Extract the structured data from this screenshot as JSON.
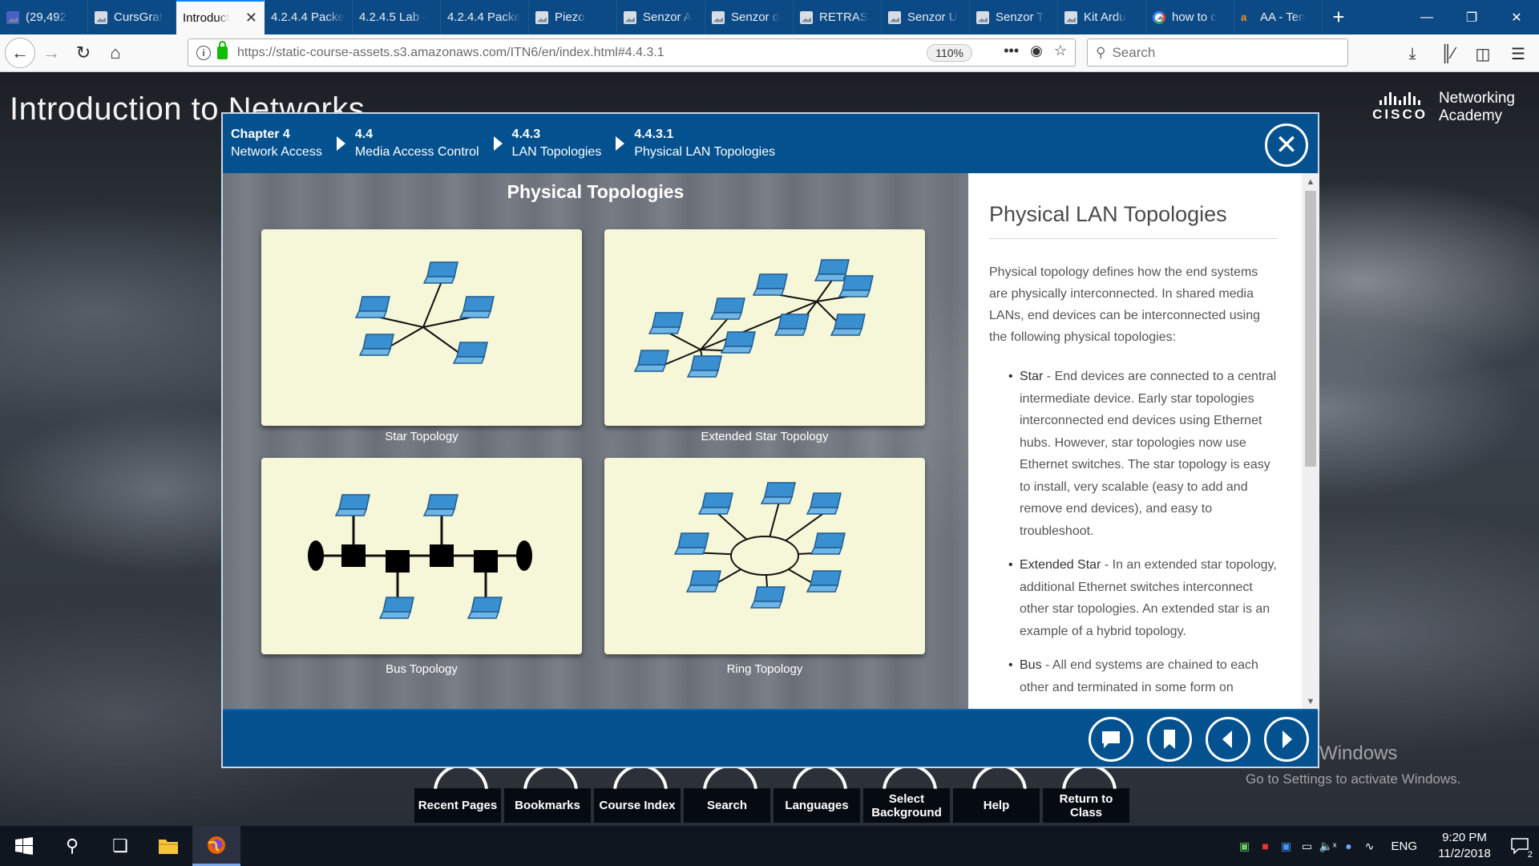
{
  "browser": {
    "tabs": [
      {
        "label": "(29,492",
        "icon": "mail-icon",
        "active": false
      },
      {
        "label": "CursGrat",
        "icon": "page-icon",
        "active": false
      },
      {
        "label": "Introduct",
        "icon": "none",
        "active": true
      },
      {
        "label": "4.2.4.4 Packe",
        "icon": "none",
        "active": false
      },
      {
        "label": "4.2.4.5 Lab -",
        "icon": "none",
        "active": false
      },
      {
        "label": "4.2.4.4 Packe",
        "icon": "none",
        "active": false
      },
      {
        "label": "Piezo",
        "icon": "page-icon",
        "active": false
      },
      {
        "label": "Senzor A",
        "icon": "page-icon",
        "active": false
      },
      {
        "label": "Senzor d",
        "icon": "page-icon",
        "active": false
      },
      {
        "label": "RETRAS",
        "icon": "page-icon",
        "active": false
      },
      {
        "label": "Senzor U",
        "icon": "page-icon",
        "active": false
      },
      {
        "label": "Senzor T",
        "icon": "page-icon",
        "active": false
      },
      {
        "label": "Kit Ardu",
        "icon": "page-icon",
        "active": false
      },
      {
        "label": "how to c",
        "icon": "google-icon",
        "active": false
      },
      {
        "label": "AA - Ten",
        "icon": "amazon-icon",
        "active": false
      }
    ],
    "url": "https://static-course-assets.s3.amazonaws.com/ITN6/en/index.html#4.4.3.1",
    "zoom": "110%",
    "search_placeholder": "Search"
  },
  "page": {
    "course_title": "Introduction to Networks",
    "logo": {
      "line1": "Networking",
      "line2": "Academy",
      "brand": "CISCO"
    },
    "bottom_menu": [
      "Recent Pages",
      "Bookmarks",
      "Course Index",
      "Search",
      "Languages",
      "Select Background",
      "Help",
      "Return to Class"
    ],
    "watermark": {
      "line1": "Activate Windows",
      "line2": "Go to Settings to activate Windows."
    }
  },
  "modal": {
    "breadcrumbs": [
      {
        "num": "Chapter 4",
        "title": "Network Access"
      },
      {
        "num": "4.4",
        "title": "Media Access Control"
      },
      {
        "num": "4.4.3",
        "title": "LAN Topologies"
      },
      {
        "num": "4.4.3.1",
        "title": "Physical LAN Topologies"
      }
    ],
    "figure_title": "Physical Topologies",
    "captions": {
      "star": "Star Topology",
      "extended": "Extended Star Topology",
      "bus": "Bus Topology",
      "ring": "Ring Topology"
    },
    "heading": "Physical LAN Topologies",
    "intro": "Physical topology defines how the end systems are physically interconnected. In shared media LANs, end devices can be interconnected using the following physical topologies:",
    "bullets": [
      {
        "term": "Star",
        "text": " - End devices are connected to a central intermediate device. Early star topologies interconnected end devices using Ethernet hubs. However, star topologies now use Ethernet switches. The star topology is easy to install, very scalable (easy to add and remove end devices), and easy to troubleshoot."
      },
      {
        "term": "Extended Star",
        "text": " - In an extended star topology, additional Ethernet switches interconnect other star topologies. An extended star is an example of a hybrid topology."
      },
      {
        "term": "Bus",
        "text": " - All end systems are chained to each other and terminated in some form on"
      }
    ]
  },
  "taskbar": {
    "lang": "ENG",
    "time": "9:20 PM",
    "date": "11/2/2018",
    "notifications": "2"
  }
}
